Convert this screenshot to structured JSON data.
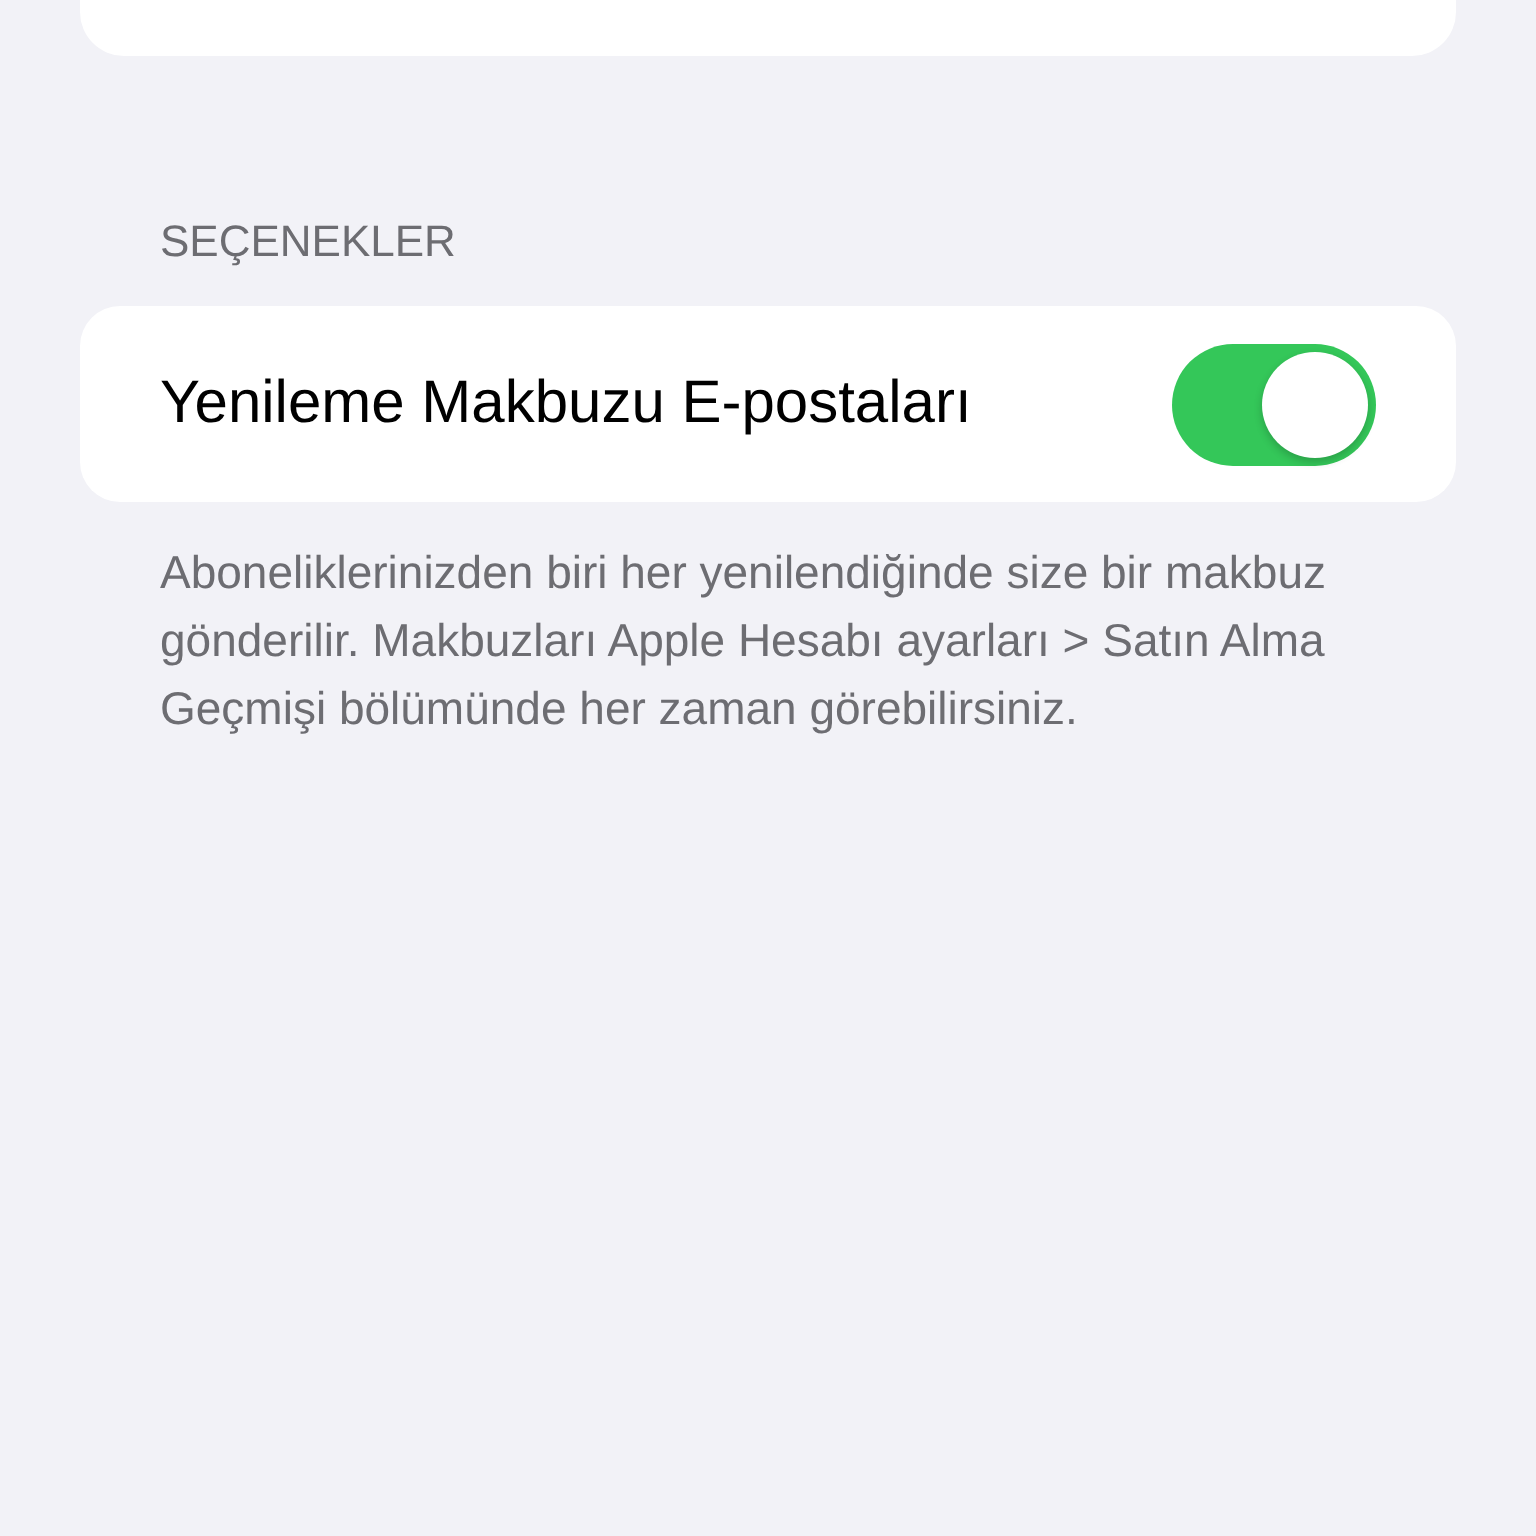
{
  "options_section": {
    "header": "SEÇENEKLER",
    "rows": [
      {
        "kind": "toggle",
        "label": "Yenileme Makbuzu E-postaları",
        "on": true
      }
    ],
    "footer": "Aboneliklerinizden biri her yenilendiğinde size bir makbuz gönderilir. Makbuzları Apple Hesabı ayarları > Satın Alma Geçmişi bölümünde her zaman görebilirsiniz."
  }
}
